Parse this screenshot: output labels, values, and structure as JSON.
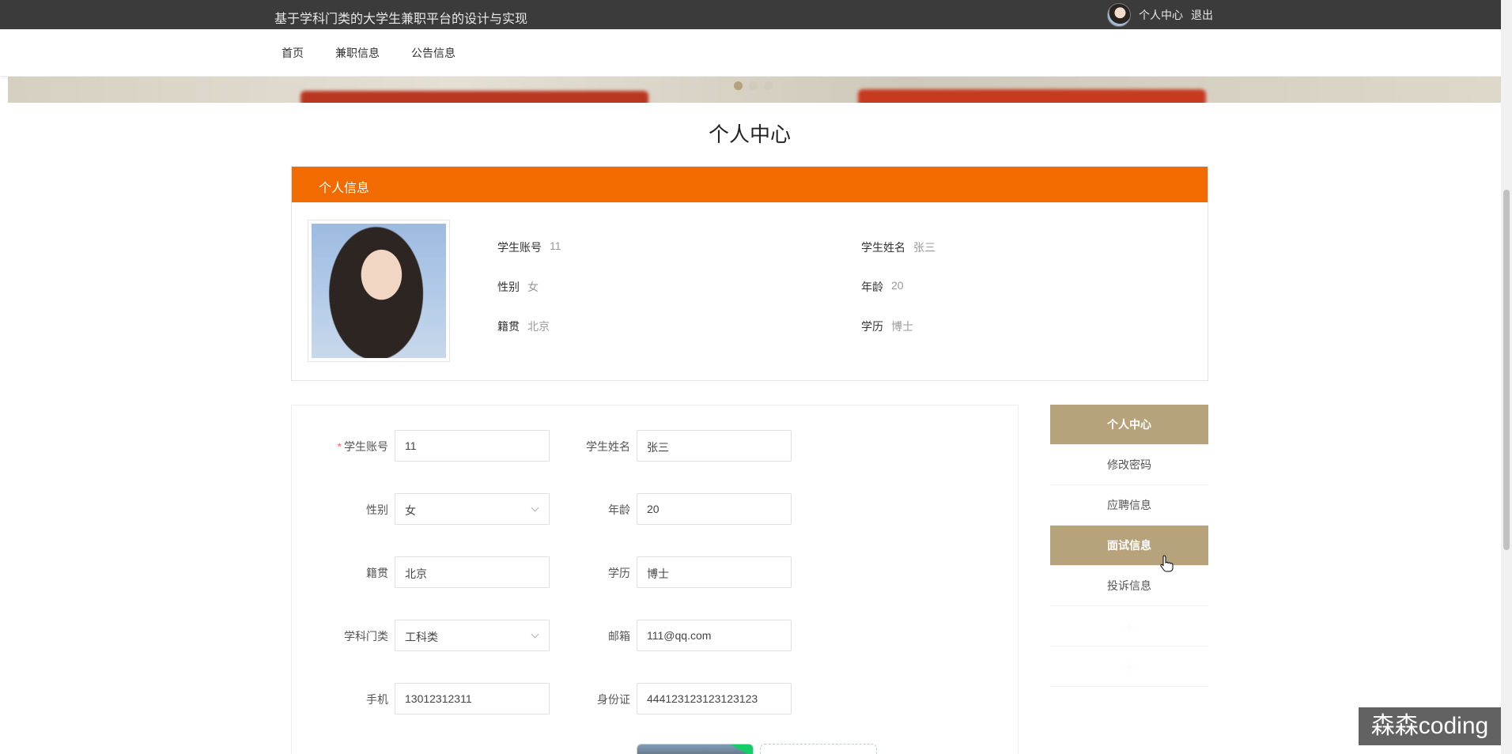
{
  "topbar": {
    "site_title": "基于学科门类的大学生兼职平台的设计与实现",
    "user_center": "个人中心",
    "logout": "退出"
  },
  "nav": {
    "items": [
      {
        "label": "首页"
      },
      {
        "label": "兼职信息"
      },
      {
        "label": "公告信息"
      }
    ]
  },
  "carousel": {
    "slide_count": 3,
    "active_index": 0
  },
  "page_heading": "个人中心",
  "info_card": {
    "header": "个人信息",
    "fields": [
      {
        "label": "学生账号",
        "value": "11"
      },
      {
        "label": "学生姓名",
        "value": "张三"
      },
      {
        "label": "性别",
        "value": "女"
      },
      {
        "label": "年龄",
        "value": "20"
      },
      {
        "label": "籍贯",
        "value": "北京"
      },
      {
        "label": "学历",
        "value": "博士"
      }
    ]
  },
  "form": {
    "required_mark": "*",
    "fields": [
      {
        "label": "学生账号",
        "value": "11",
        "type": "input"
      },
      {
        "label": "学生姓名",
        "value": "张三",
        "type": "input"
      },
      {
        "label": "性别",
        "value": "女",
        "type": "select"
      },
      {
        "label": "年龄",
        "value": "20",
        "type": "input"
      },
      {
        "label": "籍贯",
        "value": "北京",
        "type": "input"
      },
      {
        "label": "学历",
        "value": "博士",
        "type": "input"
      },
      {
        "label": "学科门类",
        "value": "工科类",
        "type": "select"
      },
      {
        "label": "邮箱",
        "value": "111@qq.com",
        "type": "input"
      },
      {
        "label": "手机",
        "value": "13012312311",
        "type": "input"
      },
      {
        "label": "身份证",
        "value": "444123123123123123",
        "type": "input"
      }
    ]
  },
  "side_menu": {
    "items": [
      {
        "label": "个人中心",
        "active": true
      },
      {
        "label": "修改密码",
        "active": false
      },
      {
        "label": "应聘信息",
        "active": false
      },
      {
        "label": "面试信息",
        "active": true
      },
      {
        "label": "投诉信息",
        "active": false
      }
    ]
  },
  "watermark": "森森coding",
  "colors": {
    "topbar_bg": "#3b3b3b",
    "info_header_bg": "#f26b00",
    "menu_active_bg": "#b7a37b",
    "required": "#f56c6c"
  }
}
